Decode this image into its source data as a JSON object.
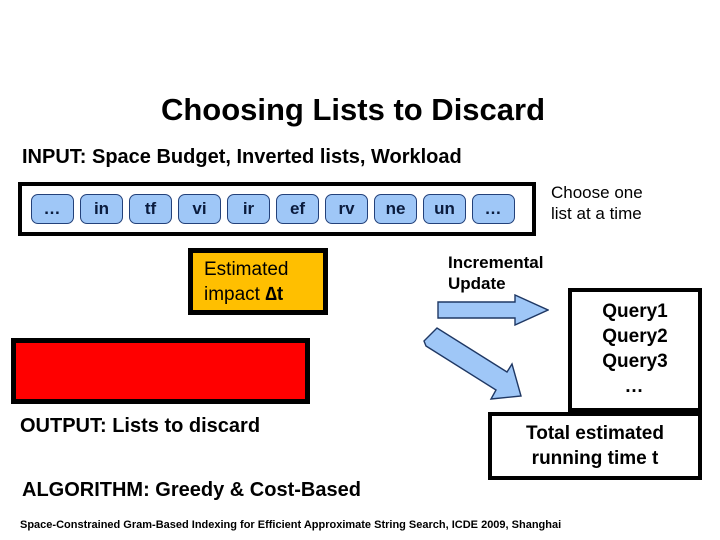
{
  "slide": {
    "title": "Choosing Lists to Discard",
    "input_label": "INPUT: Space Budget, Inverted lists, Workload",
    "output_label": "OUTPUT: Lists to discard",
    "algorithm_label": "ALGORITHM: Greedy & Cost-Based",
    "footer": "Space-Constrained Gram-Based Indexing for Efficient Approximate String Search, ICDE 2009, Shanghai"
  },
  "gram_list": {
    "name": "inverted-lists-strip",
    "cells": [
      "…",
      "in",
      "tf",
      "vi",
      "ir",
      "ef",
      "rv",
      "ne",
      "un",
      "…"
    ]
  },
  "choose_note": {
    "line1": "Choose one",
    "line2": "list at a time"
  },
  "estimated_impact": {
    "line1": "Estimated",
    "line2_prefix": "impact ",
    "line2_symbol": "∆t",
    "fill_color": "#FFBF00"
  },
  "incremental_update": {
    "line1": "Incremental",
    "line2": "Update"
  },
  "arrows": {
    "right_arrow_name": "update-arrow-right",
    "diagonal_arrow_name": "update-arrow-diagonal",
    "fill_color": "#9FC7F7",
    "stroke_color": "#1F3864"
  },
  "query_box": {
    "lines": [
      "Query1",
      "Query2",
      "Query3",
      "…"
    ]
  },
  "red_box": {
    "fill_color": "#FF0000",
    "label": ""
  },
  "total_time_box": {
    "line1": "Total estimated",
    "line2": "running time t"
  }
}
